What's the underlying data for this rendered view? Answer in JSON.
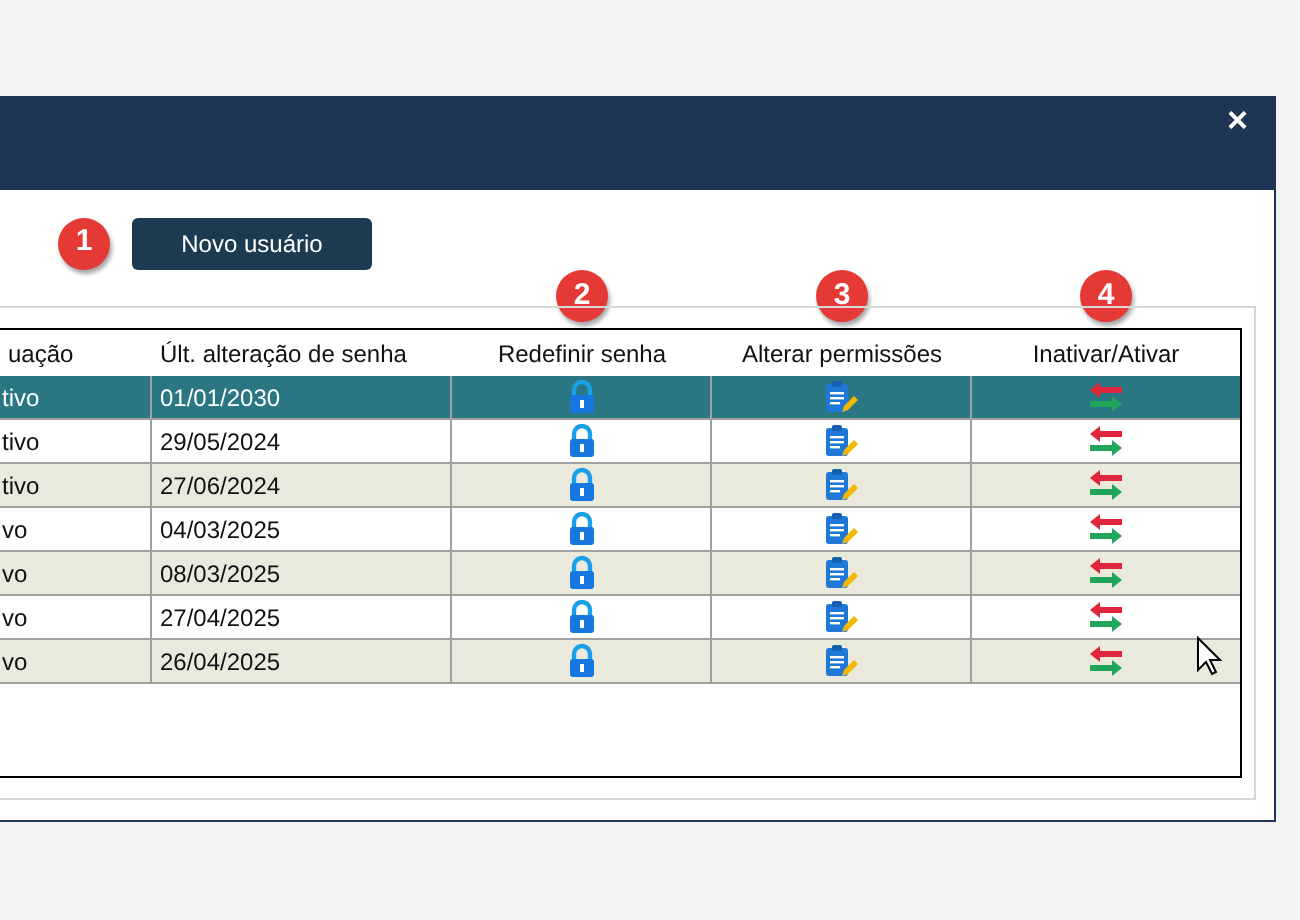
{
  "window": {
    "close": "×"
  },
  "toolbar": {
    "badge": "1",
    "new_user_button": "Novo usuário"
  },
  "table": {
    "columns": [
      {
        "label": "uação"
      },
      {
        "label": "Últ. alteração de senha"
      },
      {
        "label": "Redefinir senha",
        "badge": "2"
      },
      {
        "label": "Alterar permissões",
        "badge": "3"
      },
      {
        "label": "Inativar/Ativar",
        "badge": "4"
      }
    ],
    "rows": [
      {
        "situacao": "tivo",
        "last_change": "01/01/2030",
        "selected": true
      },
      {
        "situacao": "tivo",
        "last_change": "29/05/2024",
        "selected": false
      },
      {
        "situacao": "tivo",
        "last_change": "27/06/2024",
        "selected": false
      },
      {
        "situacao": "vo",
        "last_change": "04/03/2025",
        "selected": false
      },
      {
        "situacao": "vo",
        "last_change": "08/03/2025",
        "selected": false
      },
      {
        "situacao": "vo",
        "last_change": "27/04/2025",
        "selected": false
      },
      {
        "situacao": "vo",
        "last_change": "26/04/2025",
        "selected": false
      }
    ]
  }
}
